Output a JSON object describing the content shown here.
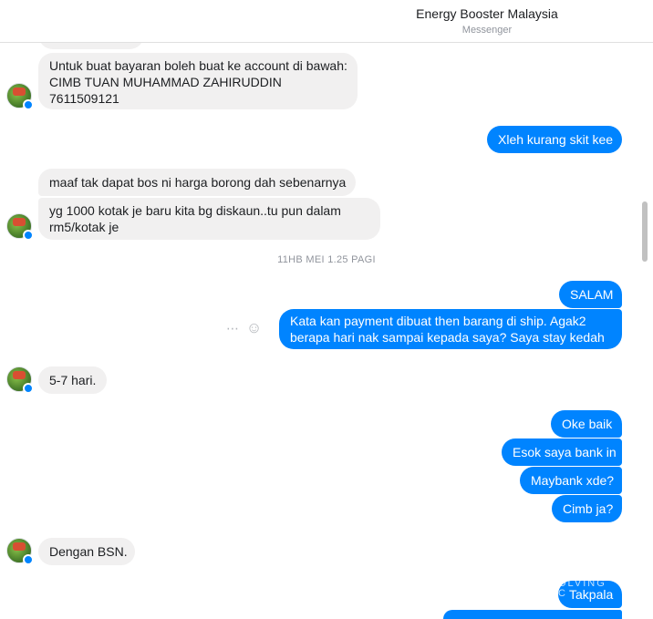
{
  "header": {
    "title": "Energy Booster Malaysia",
    "subtitle": "Messenger"
  },
  "messages": {
    "m1": "Untuk buat bayaran boleh buat ke account di bawah:",
    "m1b": "CIMB TUAN MUHAMMAD ZAHIRUDDIN",
    "m1c": "7611509121",
    "m2": "Xleh kurang skit kee",
    "m3": "maaf tak dapat bos ni harga borong dah sebenarnya",
    "m4a": "yg 1000 kotak je baru kita bg diskaun..tu pun dalam",
    "m4b": "rm5/kotak je",
    "timestamp": "11HB MEI 1.25 PAGI",
    "m5": "SALAM",
    "m6a": "Kata kan payment dibuat then barang di ship. Agak2",
    "m6b": "berapa hari nak sampai kepada saya? Saya stay kedah",
    "m7": "5-7 hari.",
    "m8": "Oke baik",
    "m9": "Esok saya bank in",
    "m10": "Maybank xde?",
    "m11": "Cimb ja?",
    "m12": "Dengan BSN.",
    "m13": "Takpala"
  },
  "icons": {
    "more": "⋯",
    "emoji": "☺"
  },
  "watermark": {
    "line1": "OLVING",
    "line2": "C"
  },
  "colors": {
    "outgoing": "#0084ff",
    "incoming": "#f1f0f0"
  }
}
